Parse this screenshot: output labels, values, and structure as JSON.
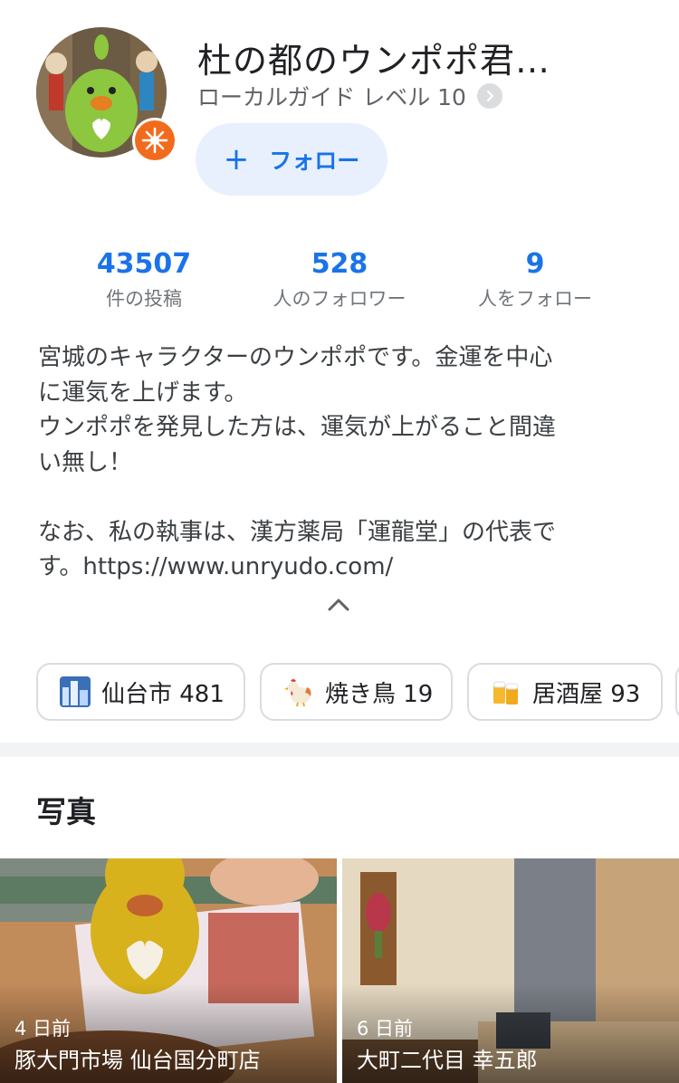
{
  "profile": {
    "name": "杜の都のウンポポ君…",
    "guide_level": "ローカルガイド レベル 10",
    "follow_label": "フォロー",
    "badge_icon": "local-guide-star-icon",
    "accent": "#1a73e8"
  },
  "stats": [
    {
      "value": "43507",
      "label": "件の投稿"
    },
    {
      "value": "528",
      "label": "人のフォロワー"
    },
    {
      "value": "9",
      "label": "人をフォロー"
    }
  ],
  "bio": "宮城のキャラクターのウンポポです。金運を中心\nに運気を上げます。\nウンポポを発見した方は、運気が上がること間違\nい無し！\n\nなお、私の執事は、漢方薬局「運龍堂」の代表で\nす。https://www.unryudo.com/",
  "chips": [
    {
      "label": "仙台市 481",
      "icon": "cityscape-icon"
    },
    {
      "label": "焼き鳥 19",
      "icon": "rooster-icon"
    },
    {
      "label": "居酒屋 93",
      "icon": "beer-mugs-icon"
    }
  ],
  "photos_section": {
    "title": "写真",
    "items": [
      {
        "age": "4 日前",
        "place": "豚大門市場 仙台国分町店"
      },
      {
        "age": "6 日前",
        "place": "大町二代目 幸五郎"
      }
    ]
  }
}
